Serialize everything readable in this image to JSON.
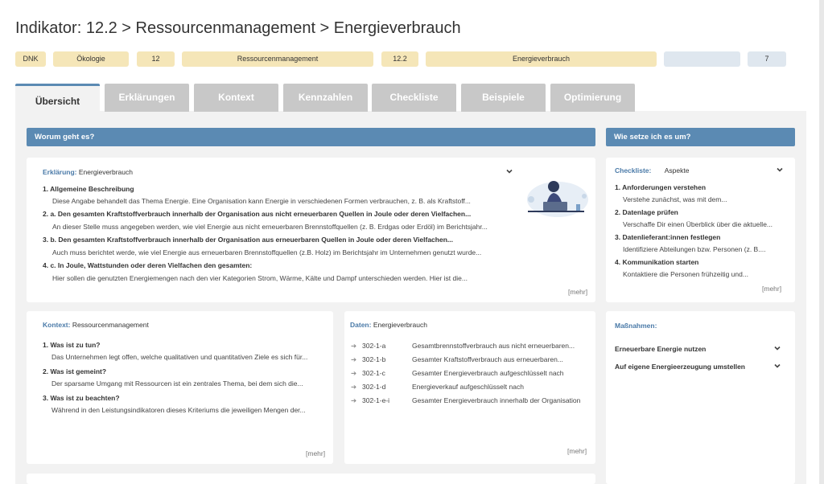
{
  "page_title": "Indikator: 12.2 > Ressourcenmanagement > Energieverbrauch",
  "tags": [
    "DNK",
    "Ökologie",
    "12",
    "Ressourcenmanagement",
    "12.2",
    "Energieverbrauch",
    "",
    "7"
  ],
  "tabs": [
    "Übersicht",
    "Erklärungen",
    "Kontext",
    "Kennzahlen",
    "Checkliste",
    "Beispiele",
    "Optimierung"
  ],
  "left_header": "Worum geht es?",
  "right_header": "Wie setze ich es um?",
  "erklaerung": {
    "label": "Erklärung:",
    "value": "Energieverbrauch",
    "items": [
      {
        "title": "1.  Allgemeine Beschreibung",
        "desc": "Diese Angabe behandelt das Thema Energie. Eine Organisation kann Energie in verschiedenen Formen verbrauchen, z. B. als Kraftstoff..."
      },
      {
        "title": "2.  a. Den gesamten Kraftstoffverbrauch innerhalb der Organisation aus nicht erneuerbaren Quellen in Joule oder deren Vielfachen...",
        "desc": "An dieser Stelle muss angegeben werden, wie viel Energie aus nicht erneuerbaren Brennstoffquellen (z. B. Erdgas oder Erdöl) im Berichtsjahr..."
      },
      {
        "title": "3.  b. Den gesamten Kraftstoffverbrauch innerhalb der Organisation aus erneuerbaren Quellen in Joule oder deren Vielfachen...",
        "desc": "Auch muss berichtet werde, wie viel Energie aus erneuerbaren Brennstoffquellen (z.B. Holz) im Berichtsjahr im Unternehmen genutzt wurde..."
      },
      {
        "title": "4.  c. In Joule, Wattstunden oder deren Vielfachen den gesamten:",
        "desc": "Hier sollen die genutzten Energiemengen nach den vier Kategorien Strom, Wärme, Kälte und Dampf unterschieden werden. Hier ist die..."
      }
    ],
    "more": "[mehr]"
  },
  "checkliste": {
    "label": "Checkliste:",
    "value": "Aspekte",
    "items": [
      {
        "title": "1. Anforderungen verstehen",
        "desc": "Verstehe zunächst, was mit dem..."
      },
      {
        "title": "2.  Datenlage prüfen",
        "desc": "Verschaffe Dir einen Überblick über die aktuelle..."
      },
      {
        "title": "3. Datenlieferant:innen festlegen",
        "desc": "Identifiziere Abteilungen bzw. Personen (z. B...."
      },
      {
        "title": "4. Kommunikation starten",
        "desc": "Kontaktiere die Personen frühzeitig und..."
      }
    ],
    "more": "[mehr]"
  },
  "kontext": {
    "label": "Kontext:",
    "value": "Ressourcenmanagement",
    "items": [
      {
        "title": "1. Was ist zu tun?",
        "desc": "Das Unternehmen legt offen, welche qualitativen und quantitativen Ziele es sich für..."
      },
      {
        "title": "2. Was ist gemeint?",
        "desc": "Der sparsame Umgang mit Ressourcen ist ein zentrales Thema, bei dem sich die..."
      },
      {
        "title": "3. Was ist zu beachten?",
        "desc": "Während in den Leistungsindikatoren dieses Kriteriums die jeweiligen Mengen der..."
      }
    ],
    "more": "[mehr]"
  },
  "daten": {
    "label": "Daten:",
    "value": "Energieverbrauch",
    "rows": [
      {
        "code": "302-1-a",
        "text": "Gesamtbrennstoffverbrauch aus nicht erneuerbaren..."
      },
      {
        "code": "302-1-b",
        "text": "Gesamter Kraftstoffverbrauch aus erneuerbaren..."
      },
      {
        "code": "302-1-c",
        "text": "Gesamter Energieverbrauch aufgeschlüsselt nach"
      },
      {
        "code": "302-1-d",
        "text": "Energieverkauf aufgeschlüsselt nach"
      },
      {
        "code": "302-1-e-i",
        "text": "Gesamter Energieverbrauch innerhalb der Organisation"
      }
    ],
    "arrow": "➔",
    "more": "[mehr]"
  },
  "massnahmen": {
    "label": "Maßnahmen:",
    "items": [
      "Erneuerbare Energie nutzen",
      "Auf eigene Energieerzeugung umstellen"
    ]
  },
  "colors": {
    "accent": "#5b8ab3",
    "tag": "#f5e6b8",
    "tag_blue": "#dfe7ef",
    "tab_inactive": "#c8c8c8",
    "panel_bg": "#f2f2f2"
  }
}
